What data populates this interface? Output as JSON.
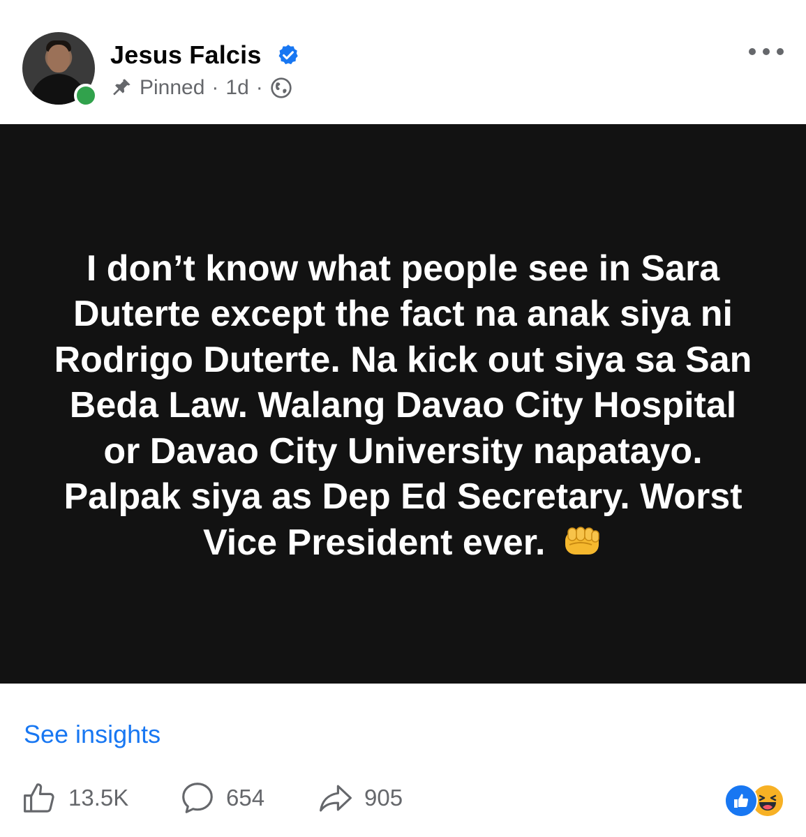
{
  "author": {
    "name": "Jesus Falcis",
    "verified": true,
    "online": true
  },
  "meta": {
    "pinned_label": "Pinned",
    "time": "1d",
    "separator": "·",
    "audience_icon": "globe-icon"
  },
  "post": {
    "background_color": "#121212",
    "text": "I don’t know what people see in Sara Duterte except the fact na anak siya ni Rodrigo Duterte. Na kick out siya sa San Beda Law. Walang Davao City Hospital or Davao City University napatayo. Palpak siya as Dep Ed Secretary. Worst Vice President ever.",
    "emoji": "fist-icon"
  },
  "insights_link": "See insights",
  "actions": {
    "likes": "13.5K",
    "comments": "654",
    "shares": "905"
  },
  "reactions": [
    "like-icon",
    "haha-icon"
  ],
  "colors": {
    "accent": "#1877f2",
    "secondary_text": "#65676b",
    "online": "#31a24c"
  }
}
